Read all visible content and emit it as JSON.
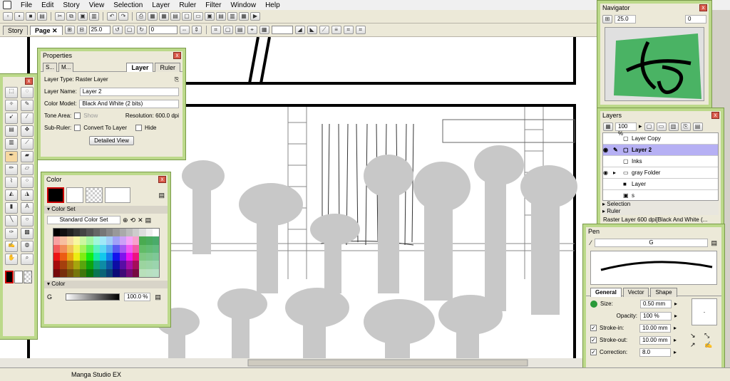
{
  "menu": [
    "File",
    "Edit",
    "Story",
    "View",
    "Selection",
    "Layer",
    "Ruler",
    "Filter",
    "Window",
    "Help"
  ],
  "doc_tabs": [
    {
      "label": "Story"
    },
    {
      "label": "Page",
      "active": true
    }
  ],
  "page_tab_close": "✕",
  "toolbar2": {
    "zoom": "25.0",
    "angle": "0"
  },
  "properties": {
    "title": "Properties",
    "tabs": [
      "S...",
      "M...",
      "Layer",
      "Ruler"
    ],
    "layer_type": "Layer Type: Raster Layer",
    "layer_name_label": "Layer Name:",
    "layer_name": "Layer 2",
    "color_model_label": "Color Model:",
    "color_model": "Black And White (2 bits)",
    "tone_area_label": "Tone Area:",
    "show_label": "Show",
    "resolution": "Resolution: 600.0 dpi",
    "subruler_label": "Sub-Ruler:",
    "convert_label": "Convert To Layer",
    "hide_label": "Hide",
    "detailed_view": "Detailed View"
  },
  "color_panel": {
    "title": "Color",
    "color_set_header": "Color Set",
    "color_set_select": "Standard Color Set",
    "color_header": "Color",
    "channel": "G",
    "percent": "100.0 %"
  },
  "navigator": {
    "title": "Navigator",
    "zoom": "25.0",
    "angle": "0"
  },
  "layers_panel": {
    "title": "Layers",
    "opacity": "100 %",
    "layers": [
      {
        "name": "Layer Copy",
        "visible": false,
        "selected": false
      },
      {
        "name": "Layer 2",
        "visible": true,
        "selected": true
      },
      {
        "name": "Inks",
        "visible": false,
        "selected": false
      },
      {
        "name": "gray Folder",
        "visible": true,
        "selected": false
      },
      {
        "name": "Layer",
        "visible": false,
        "selected": false
      },
      {
        "name": "s",
        "visible": false,
        "selected": false
      }
    ],
    "selection_label": "Selection",
    "ruler_label": "Ruler",
    "status": "Raster Layer 600 dpi[Black And White (..."
  },
  "pen_panel": {
    "title": "Pen",
    "brush_name": "G",
    "tabs": [
      "General",
      "Vector",
      "Shape"
    ],
    "size_label": "Size:",
    "size": "0.50 mm",
    "opacity_label": "Opacity:",
    "opacity": "100 %",
    "stroke_in_label": "Stroke-in:",
    "stroke_in": "10.00 mm",
    "stroke_out_label": "Stroke-out:",
    "stroke_out": "10.00 mm",
    "correction_label": "Correction:",
    "correction": "8.0"
  },
  "status_text": "Manga Studio EX",
  "colors": {
    "accent_panel_border": "#bcd98a",
    "selected_layer": "#b6b0f4",
    "silhouette": "#c8c8c8",
    "watermark": "#2faa4e"
  }
}
